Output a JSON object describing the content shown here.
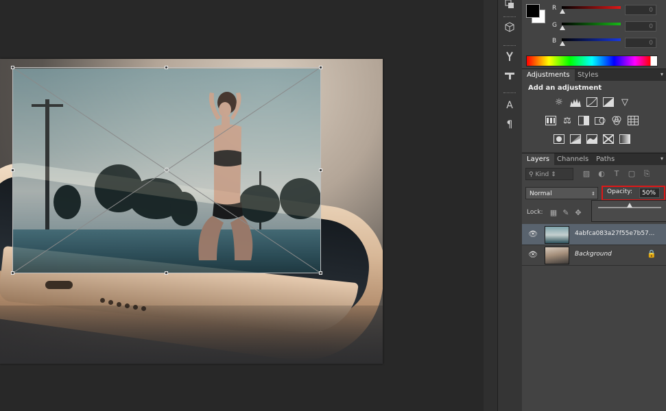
{
  "tool_strip": {
    "icons": [
      "layer-comps-icon",
      "3d-icon",
      "brush-presets-icon",
      "tool-presets-icon",
      "character-icon",
      "paragraph-icon"
    ],
    "glyphs": {
      "character": "A",
      "paragraph": "¶"
    }
  },
  "color_panel": {
    "foreground": "#000000",
    "background": "#ffffff",
    "channels": [
      {
        "label": "R",
        "value": "0",
        "color": "#e01818"
      },
      {
        "label": "G",
        "value": "0",
        "color": "#18b818"
      },
      {
        "label": "B",
        "value": "0",
        "color": "#1838e0"
      }
    ]
  },
  "adjustments_tabs": [
    "Adjustments",
    "Styles"
  ],
  "adjustments": {
    "title": "Add an adjustment",
    "icons": [
      [
        "brightness-icon",
        "levels-icon",
        "curves-icon",
        "exposure-icon",
        "vibrance-icon"
      ],
      [
        "hue-saturation-icon",
        "color-balance-icon",
        "black-white-icon",
        "photo-filter-icon",
        "channel-mixer-icon",
        "color-lookup-icon"
      ],
      [
        "invert-icon",
        "posterize-icon",
        "threshold-icon",
        "selective-color-icon",
        "gradient-map-icon"
      ]
    ]
  },
  "layers_tabs": [
    "Layers",
    "Channels",
    "Paths"
  ],
  "layers": {
    "kind_label": "Kind",
    "blend_mode": "Normal",
    "opacity_label": "Opacity:",
    "opacity_value": "50%",
    "opacity_fraction": 0.5,
    "lock_label": "Lock:",
    "items": [
      {
        "name": "4abfca083a27f55e7b57...",
        "visible": true,
        "selected": true,
        "locked": false
      },
      {
        "name": "Background",
        "visible": true,
        "selected": false,
        "locked": true
      }
    ]
  }
}
